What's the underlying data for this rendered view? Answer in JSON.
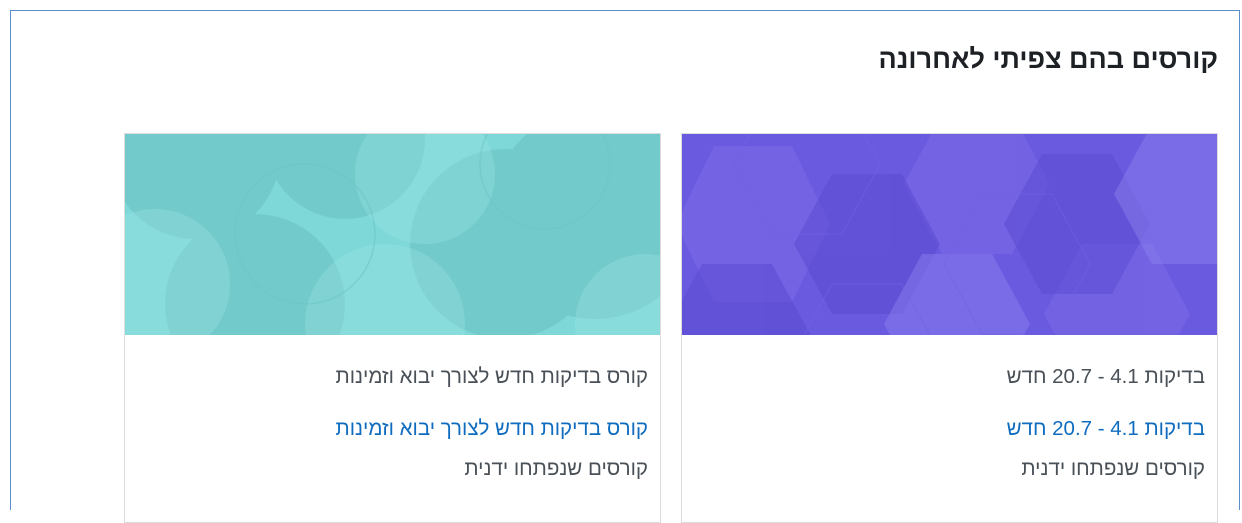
{
  "block": {
    "title": "קורסים בהם צפיתי לאחרונה"
  },
  "courses": [
    {
      "category": "בדיקות 4.1 - 20.7 חדש",
      "name": "בדיקות 4.1 - 20.7 חדש",
      "type": "קורסים שנפתחו ידנית",
      "image_pattern": "hexagons",
      "image_color": "#6a5ae0"
    },
    {
      "category": "קורס בדיקות חדש לצורך יבוא וזמינות",
      "name": "קורס בדיקות חדש לצורך יבוא וזמינות",
      "type": "קורסים שנפתחו ידנית",
      "image_pattern": "circles",
      "image_color": "#7fd8d8"
    }
  ],
  "colors": {
    "frame_border": "#5b8ec9",
    "link": "#0f6cbf",
    "muted_text": "#495057",
    "title_text": "#1d2125"
  }
}
